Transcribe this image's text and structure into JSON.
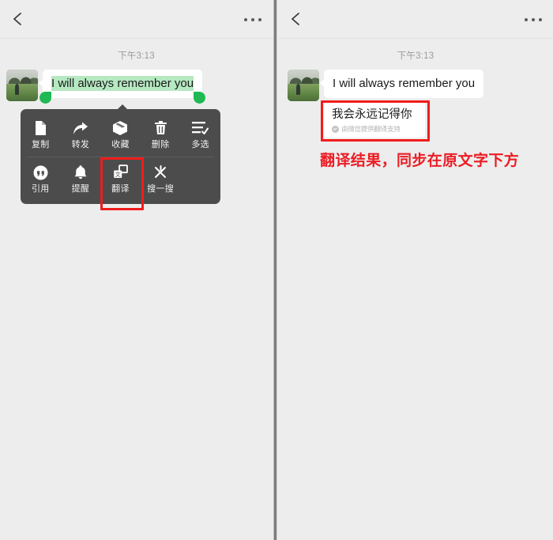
{
  "navbar": {
    "back_icon": "chevron-left-icon",
    "more_icon": "more-dots-icon"
  },
  "left_panel": {
    "timestamp": "下午3:13",
    "message": {
      "text": "I will always remember you",
      "selected": true,
      "avatar_alt": "contact-avatar-photo"
    },
    "context_menu": {
      "rows": [
        [
          {
            "label": "复制",
            "icon": "copy-icon"
          },
          {
            "label": "转发",
            "icon": "forward-arrow-icon"
          },
          {
            "label": "收藏",
            "icon": "favorite-box-icon"
          },
          {
            "label": "删除",
            "icon": "trash-icon"
          },
          {
            "label": "多选",
            "icon": "multi-select-icon"
          }
        ],
        [
          {
            "label": "引用",
            "icon": "quote-icon"
          },
          {
            "label": "提醒",
            "icon": "bell-icon"
          },
          {
            "label": "翻译",
            "icon": "translate-icon"
          },
          {
            "label": "搜一搜",
            "icon": "search-burst-icon"
          }
        ]
      ],
      "highlighted_item": "翻译"
    }
  },
  "right_panel": {
    "timestamp": "下午3:13",
    "message": {
      "text": "I will always remember you",
      "avatar_alt": "contact-avatar-photo"
    },
    "translation": {
      "text": "我会永远记得你",
      "provider_note": "由微信提供翻译支持",
      "badge_icon": "check-badge-icon"
    },
    "annotation": "翻译结果，同步在原文字下方"
  },
  "colors": {
    "background": "#ededed",
    "bubble": "#ffffff",
    "selection_highlight": "#b6e8c1",
    "selection_handle": "#1fb954",
    "context_menu": "#4c4c4c",
    "annotation_red": "#ec1c24",
    "highlight_rect_red": "#f01c1c",
    "divider_gray": "#7c7c7c"
  }
}
